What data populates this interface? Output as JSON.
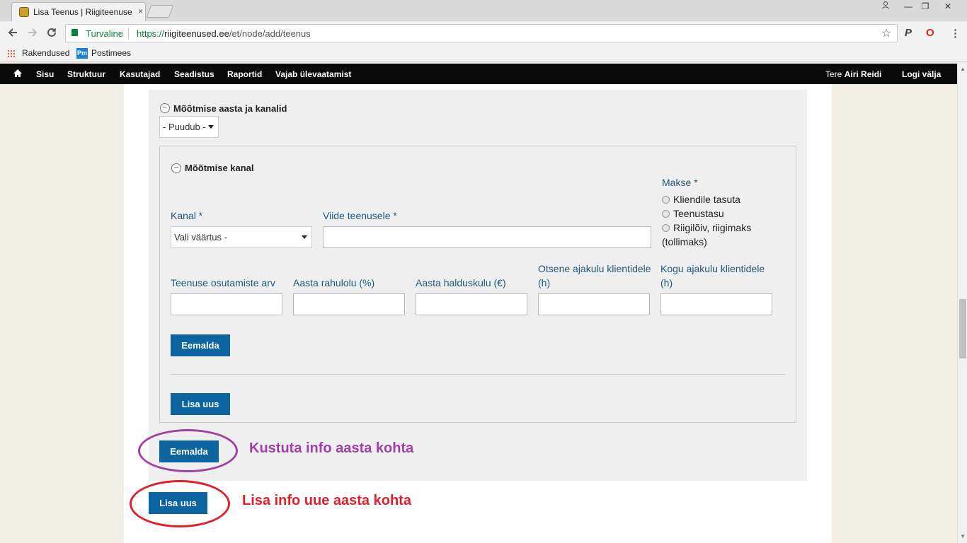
{
  "browser": {
    "tab_title": "Lisa Teenus | Riigiteenuse",
    "tab_close": "×",
    "secure_label": "Turvaline",
    "url_scheme": "https://",
    "url_host": "riigiteenused.ee",
    "url_path": "/et/node/add/teenus",
    "bookmarks": [
      "Rakendused",
      "Postimees"
    ],
    "pm_logo": "Pm",
    "window_buttons": [
      "—",
      "❐",
      "✕"
    ]
  },
  "adminbar": {
    "items": [
      "Sisu",
      "Struktuur",
      "Kasutajad",
      "Seadistus",
      "Raportid",
      "Vajab ülevaatamist"
    ],
    "greeting": "Tere",
    "user": "Airi Reidi",
    "logout": "Logi välja"
  },
  "form": {
    "year_section": {
      "legend": "Mõõtmise aasta ja kanalid",
      "year_select_value": "- Puudub -"
    },
    "channel": {
      "legend": "Mõõtmise kanal",
      "kanal_label": "Kanal *",
      "kanal_select_value": "Vali väärtus -",
      "viide_label": "Viide teenusele *",
      "viide_value": "",
      "makse_label": "Makse *",
      "makse_options": [
        "Kliendile tasuta",
        "Teenustasu",
        "Riigilõiv, riigimaks"
      ],
      "makse_option_3_cont": "(tollimaks)",
      "osutamiste_label": "Teenuse osutamiste arv",
      "rahulolu_label": "Aasta rahulolu (%)",
      "halduskulu_label": "Aasta halduskulu (€)",
      "otsene_label_1": "Otsene ajakulu klientidele",
      "otsene_label_2": "(h)",
      "kogu_label_1": "Kogu ajakulu klientidele",
      "kogu_label_2": "(h)",
      "remove_button": "Eemalda",
      "add_button": "Lisa uus"
    },
    "year_remove_button": "Eemalda",
    "year_add_button": "Lisa uus"
  },
  "annotations": {
    "remove_note": "Kustuta info aasta kohta",
    "add_note": "Lisa info uue aasta kohta",
    "remove_color": "#a040a8",
    "add_color": "#e0202a"
  }
}
